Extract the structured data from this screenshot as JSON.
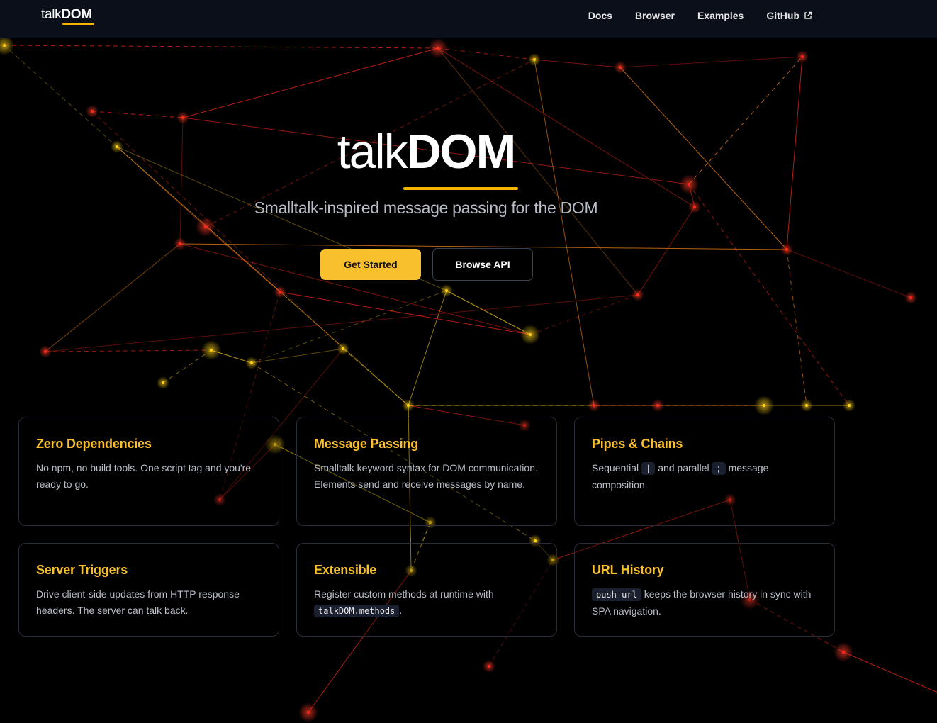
{
  "header": {
    "brand_light": "talk",
    "brand_bold": "DOM",
    "nav": [
      {
        "label": "Docs"
      },
      {
        "label": "Browser"
      },
      {
        "label": "Examples"
      },
      {
        "label": "GitHub",
        "icon": "external-link-icon"
      }
    ]
  },
  "hero": {
    "title_light": "talk",
    "title_bold": "DOM",
    "subtitle": "Smalltalk-inspired message passing for the DOM",
    "primary_button": "Get Started",
    "secondary_button": "Browse API"
  },
  "features": [
    {
      "title": "Zero Dependencies",
      "text": "No npm, no build tools. One script tag and you're ready to go."
    },
    {
      "title": "Message Passing",
      "text": "Smalltalk keyword syntax for DOM communication. Elements send and receive messages by name."
    },
    {
      "title": "Pipes & Chains",
      "text_1": "Sequential",
      "code_1": "|",
      "text_2": "and parallel",
      "code_2": ";",
      "text_3": "message composition."
    },
    {
      "title": "Server Triggers",
      "text": "Drive client-side updates from HTTP response headers. The server can talk back."
    },
    {
      "title": "Extensible",
      "text_1": "Register custom methods at runtime with",
      "code_1": "talkDOM.methods",
      "text_2": "."
    },
    {
      "title": "URL History",
      "code_1": "push-url",
      "text_1": "keeps the browser history in sync with SPA navigation."
    }
  ],
  "colors": {
    "accent": "#f9c02d",
    "background": "#000000",
    "header_bg": "#0b0f1a",
    "network_red": "#ff2a1a",
    "network_yellow": "#ffd21a"
  }
}
